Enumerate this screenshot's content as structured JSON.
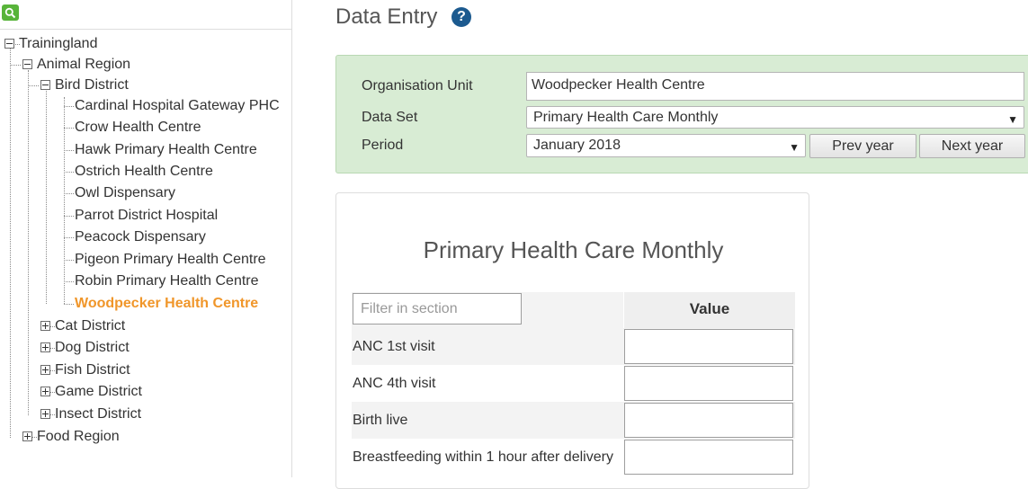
{
  "tree": {
    "root": "Trainingland",
    "animal_region": "Animal Region",
    "bird_district": "Bird District",
    "facilities": [
      "Cardinal Hospital Gateway PHC",
      "Crow Health Centre",
      "Hawk Primary Health Centre",
      "Ostrich Health Centre",
      "Owl Dispensary",
      "Parrot District Hospital",
      "Peacock Dispensary",
      "Pigeon Primary Health Centre",
      "Robin Primary Health Centre",
      "Woodpecker Health Centre"
    ],
    "selected": "Woodpecker Health Centre",
    "districts": [
      "Cat District",
      "Dog District",
      "Fish District",
      "Game District",
      "Insect District"
    ],
    "food_region": "Food Region"
  },
  "header": {
    "title": "Data Entry",
    "help_icon": "question-circle-icon"
  },
  "selection": {
    "org_unit_label": "Organisation Unit",
    "org_unit_value": "Woodpecker Health Centre",
    "data_set_label": "Data Set",
    "data_set_value": "Primary Health Care Monthly",
    "period_label": "Period",
    "period_value": "January 2018",
    "prev_year": "Prev year",
    "next_year": "Next year"
  },
  "form": {
    "title": "Primary Health Care Monthly",
    "filter_placeholder": "Filter in section",
    "value_header": "Value",
    "rows": [
      "ANC 1st visit",
      "ANC 4th visit",
      "Birth live",
      "Breastfeeding within 1 hour after delivery"
    ]
  },
  "colors": {
    "selected_orgunit": "#f0962a",
    "panel_bg": "#d8ecd4",
    "help_icon": "#1c5a8f",
    "search_button": "#58b43a"
  }
}
